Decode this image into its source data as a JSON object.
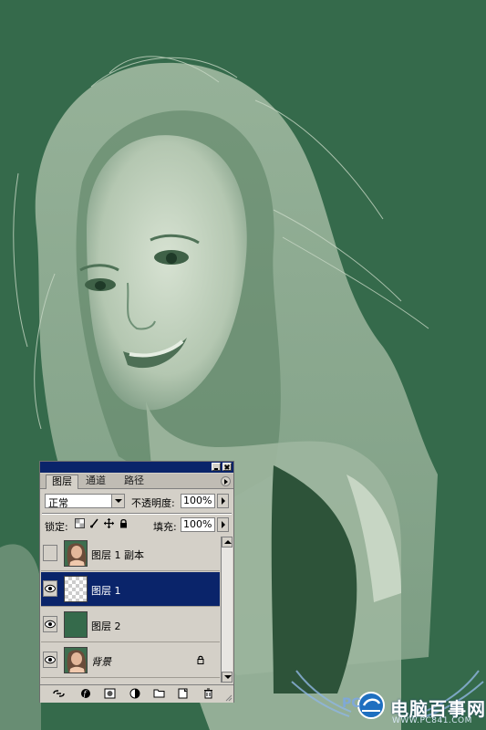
{
  "colors": {
    "canvas_bg": "#356a4b",
    "photo_tone": "#b9cbb8",
    "panel_bg": "#d4d0c8",
    "titlebar": "#0a246a",
    "selection": "#0a246a"
  },
  "panel": {
    "tabs": [
      {
        "label": "图层"
      },
      {
        "label": "通道"
      },
      {
        "label": "路径"
      }
    ],
    "blend_mode": "正常",
    "opacity_label": "不透明度:",
    "opacity_value": "100%",
    "lock_label": "锁定:",
    "fill_label": "填充:",
    "fill_value": "100%",
    "layers": [
      {
        "name": "图层 1 副本",
        "visible": false,
        "selected": false,
        "thumb": "photo"
      },
      {
        "name": "图层 1",
        "visible": true,
        "selected": true,
        "thumb": "transparent"
      },
      {
        "name": "图层 2",
        "visible": true,
        "selected": false,
        "thumb": "green"
      },
      {
        "name": "背景",
        "visible": true,
        "selected": false,
        "thumb": "photo",
        "locked": true
      }
    ],
    "bottom_icons": [
      "link-icon",
      "layer-style-icon",
      "mask-icon",
      "adjustment-icon",
      "folder-icon",
      "new-layer-icon",
      "trash-icon"
    ]
  },
  "watermark": {
    "title": "电脑百事网",
    "url": "WWW.PC841.COM"
  }
}
